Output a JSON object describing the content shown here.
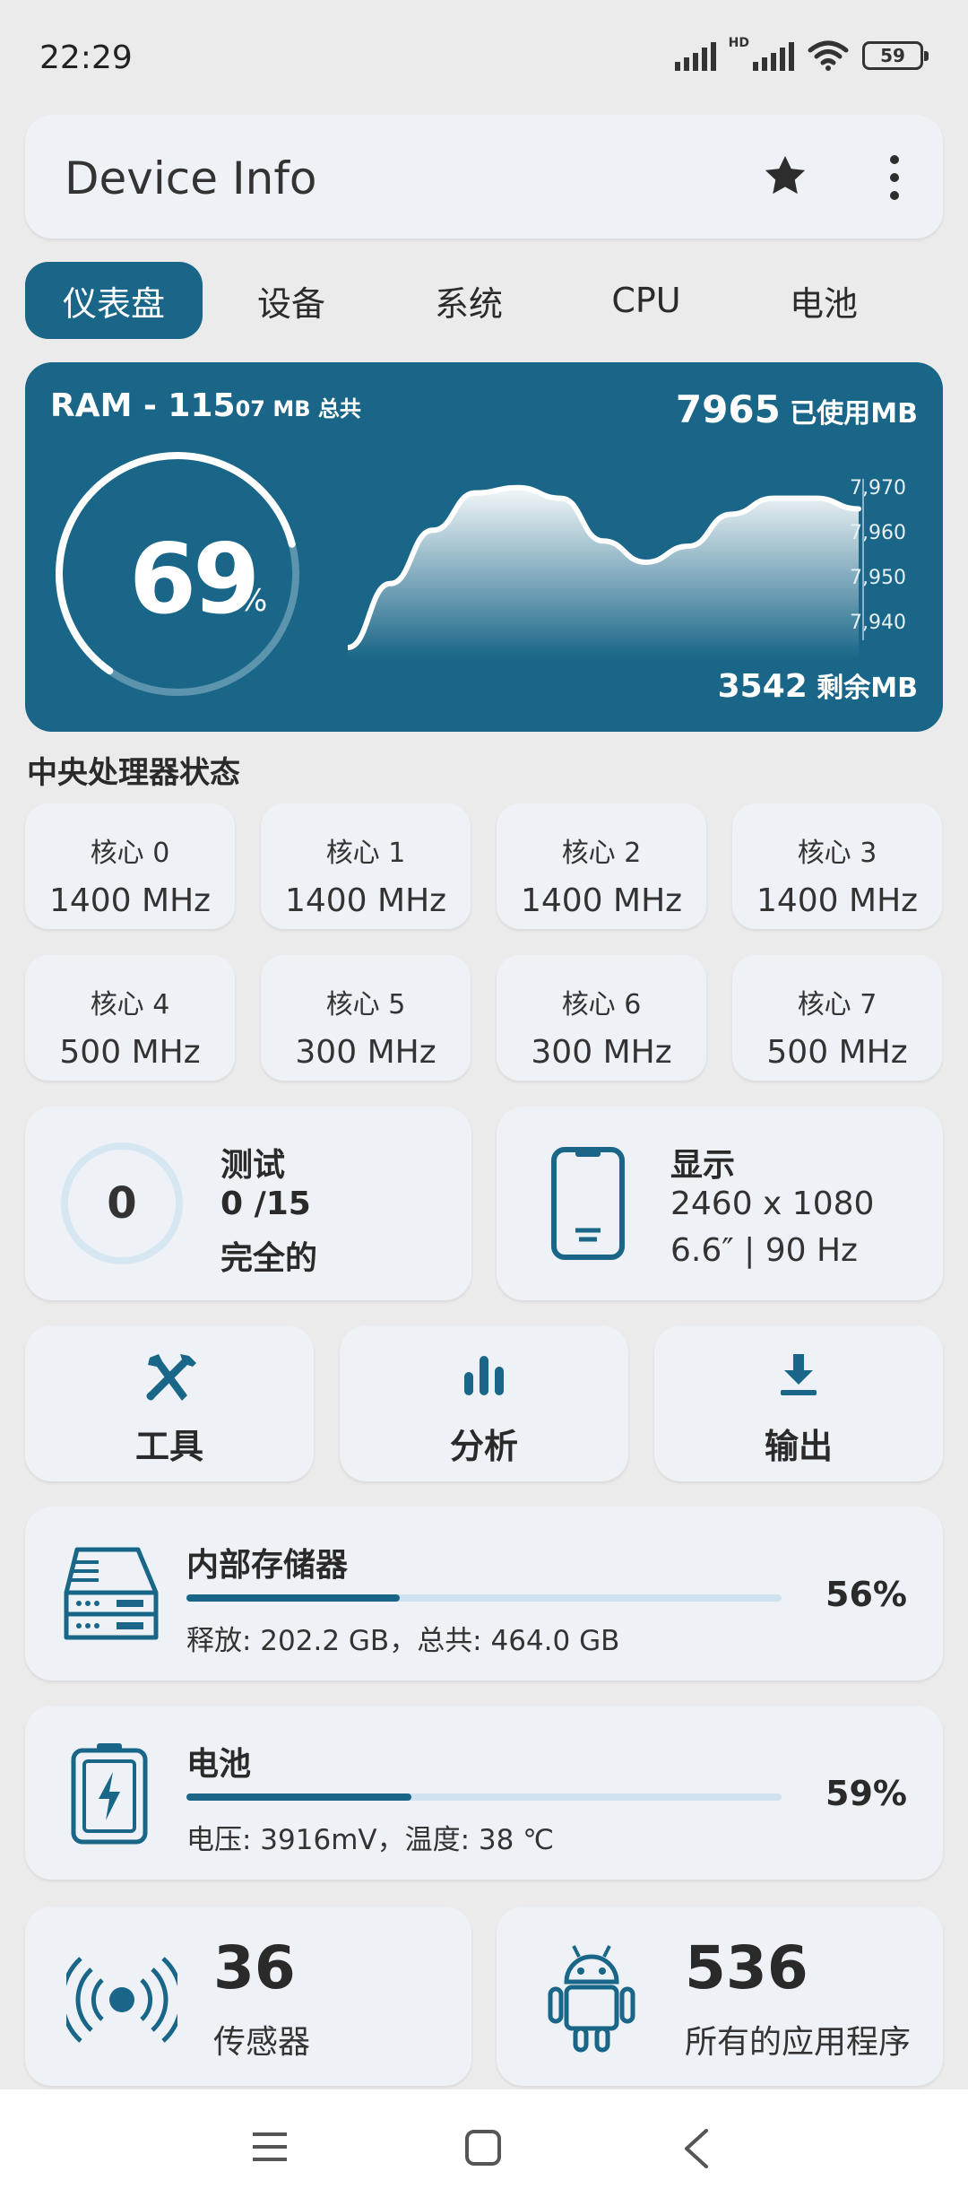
{
  "status_bar": {
    "time": "22:29",
    "battery": "59",
    "hd": "HD"
  },
  "app_bar": {
    "title": "Device Info"
  },
  "tabs": [
    {
      "label": "仪表盘",
      "active": true
    },
    {
      "label": "设备",
      "active": false
    },
    {
      "label": "系统",
      "active": false
    },
    {
      "label": "CPU",
      "active": false
    },
    {
      "label": "电池",
      "active": false
    }
  ],
  "ram": {
    "title_prefix": "RAM - 115",
    "title_suffix": "07 MB 总共",
    "used_value": "7965",
    "used_label": " 已使用MB",
    "free_value": "3542",
    "free_label": " 剩余MB",
    "percent": "69",
    "percent_sign": "%",
    "percent_fraction": 0.69,
    "y_ticks": [
      "7,970",
      "7,960",
      "7,950",
      "7,940"
    ]
  },
  "chart_data": {
    "type": "area",
    "series": [
      {
        "values": [
          7938,
          7950,
          7960,
          7967,
          7968,
          7966,
          7958,
          7954,
          7957,
          7963,
          7966,
          7966,
          7964
        ]
      }
    ],
    "y_ticks": [
      7970,
      7960,
      7950,
      7940
    ],
    "ylim": [
      7936,
      7973
    ],
    "grid": false
  },
  "cpu": {
    "section_title": "中央处理器状态",
    "cores": [
      {
        "name": "核心 0",
        "freq": "1400 MHz"
      },
      {
        "name": "核心 1",
        "freq": "1400 MHz"
      },
      {
        "name": "核心 2",
        "freq": "1400 MHz"
      },
      {
        "name": "核心 3",
        "freq": "1400 MHz"
      },
      {
        "name": "核心 4",
        "freq": "500 MHz"
      },
      {
        "name": "核心 5",
        "freq": "300 MHz"
      },
      {
        "name": "核心 6",
        "freq": "300 MHz"
      },
      {
        "name": "核心 7",
        "freq": "500 MHz"
      }
    ]
  },
  "tests": {
    "count": "0",
    "title": "测试",
    "progress": "0 /15",
    "status": "完全的"
  },
  "display": {
    "title": "显示",
    "resolution": "2460 x 1080",
    "spec": "6.6″ | 90 Hz"
  },
  "tools": [
    {
      "label": "工具",
      "icon": "tools-icon"
    },
    {
      "label": "分析",
      "icon": "analytics-icon"
    },
    {
      "label": "输出",
      "icon": "download-icon"
    }
  ],
  "storage": {
    "title": "内部存储器",
    "detail": "释放: 202.2 GB，总共: 464.0 GB",
    "percent": "56%",
    "fraction": 0.56
  },
  "battery": {
    "title": "电池",
    "detail": "电压: 3916mV，温度: 38 ℃",
    "percent": "59%",
    "fraction": 0.59
  },
  "sensors": {
    "count": "36",
    "label": "传感器"
  },
  "apps": {
    "count": "536",
    "label": "所有的应用程序"
  },
  "colors": {
    "primary": "#1a6688",
    "card": "#eef2f7",
    "background": "#ebebeb",
    "track": "#cfe2ee"
  }
}
